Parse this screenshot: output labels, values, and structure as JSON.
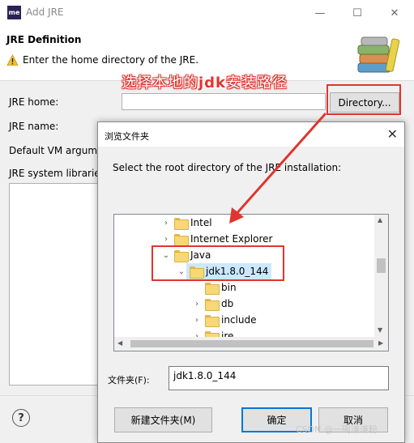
{
  "window": {
    "app_icon_text": "me",
    "title": "Add JRE",
    "minimize": "—",
    "maximize": "☐",
    "close": "✕"
  },
  "header": {
    "title": "JRE Definition",
    "message": "Enter the home directory of the JRE."
  },
  "annotation": {
    "prefix": "选择本地的",
    "bold": "jdk",
    "suffix": "安装路径"
  },
  "form": {
    "jre_home_label": "JRE home:",
    "jre_home_value": "",
    "directory_button": "Directory...",
    "jre_name_label": "JRE name:",
    "jre_name_value": "",
    "vm_args_label": "Default VM argume",
    "libraries_label": "JRE system librarie"
  },
  "help_icon": "?",
  "dialog": {
    "title": "浏览文件夹",
    "close": "✕",
    "prompt": "Select the root directory of the JRE installation:",
    "tree": [
      {
        "label": "Intel",
        "chevron": "›",
        "expanded": false,
        "selected": false
      },
      {
        "label": "Internet Explorer",
        "chevron": "›",
        "expanded": false,
        "selected": false
      },
      {
        "label": "Java",
        "chevron": "⌄",
        "expanded": true,
        "selected": false
      },
      {
        "label": "jdk1.8.0_144",
        "chevron": "⌄",
        "expanded": true,
        "selected": true
      },
      {
        "label": "bin",
        "chevron": "",
        "expanded": false,
        "selected": false
      },
      {
        "label": "db",
        "chevron": "›",
        "expanded": false,
        "selected": false
      },
      {
        "label": "include",
        "chevron": "›",
        "expanded": false,
        "selected": false
      },
      {
        "label": "jre",
        "chevron": "›",
        "expanded": false,
        "selected": false
      }
    ],
    "folder_label": "文件夹(F):",
    "folder_value": "jdk1.8.0_144",
    "new_folder_button": "新建文件夹(M)",
    "ok_button": "确定",
    "cancel_button": "取消"
  },
  "watermark": "CSDN @一碗谦谦粉",
  "colors": {
    "annotation_red": "#e0352f",
    "selection": "#cce8ff",
    "default_button_border": "#0078d7"
  }
}
